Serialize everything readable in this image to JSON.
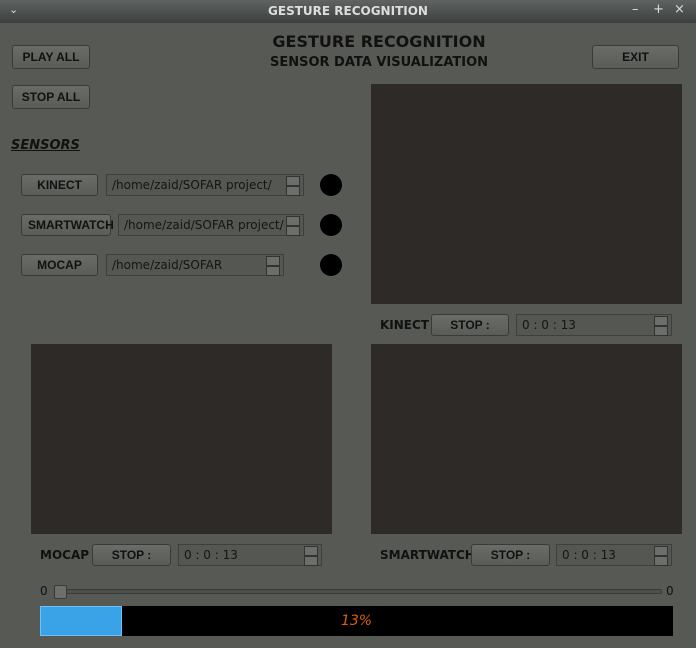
{
  "window": {
    "title": "GESTURE RECOGNITION"
  },
  "header": {
    "title": "GESTURE RECOGNITION",
    "subtitle": "SENSOR DATA VISUALIZATION"
  },
  "buttons": {
    "play_all": "PLAY ALL",
    "stop_all": "STOP ALL",
    "exit": "EXIT"
  },
  "sensors": {
    "heading": "SENSORS",
    "items": [
      {
        "label": "KINECT",
        "path": "/home/zaid/SOFAR project/"
      },
      {
        "label": "SMARTWATCH",
        "path": "/home/zaid/SOFAR project/"
      },
      {
        "label": "MOCAP",
        "path": "/home/zaid/SOFAR"
      }
    ]
  },
  "players": {
    "kinect": {
      "label": "KINECT",
      "button": "STOP :",
      "time": "0 : 0 : 13"
    },
    "mocap": {
      "label": "MOCAP",
      "button": "STOP :",
      "time": "0 : 0 : 13"
    },
    "smartwatch": {
      "label": "SMARTWATCH",
      "button": "STOP :",
      "time": "0 : 0 : 13"
    }
  },
  "slider": {
    "min": "0",
    "max": "0",
    "value": 0
  },
  "progress": {
    "value": 13,
    "text": "13%",
    "fill_color": "#3aa3e8",
    "text_color": "#d9620f"
  }
}
